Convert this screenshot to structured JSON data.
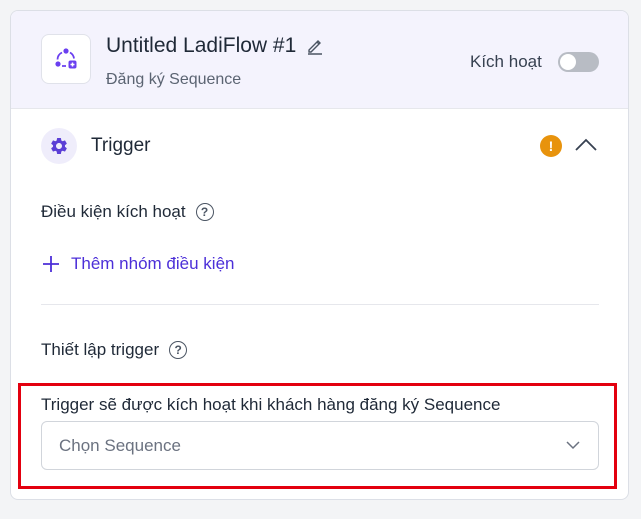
{
  "header": {
    "title": "Untitled LadiFlow #1",
    "subtitle": "Đăng ký Sequence",
    "activate_label": "Kích hoạt",
    "activate_enabled": false,
    "icons": {
      "flow": "flow-node-icon",
      "edit": "pencil-icon"
    }
  },
  "trigger_section": {
    "title": "Trigger",
    "warning_symbol": "!",
    "icons": {
      "section": "gear-icon",
      "warning": "warning-icon",
      "collapse": "chevron-up-icon"
    },
    "conditions_label": "Điều kiện kích hoạt",
    "add_group_label": "Thêm nhóm điều kiện",
    "setup_label": "Thiết lập trigger",
    "help_symbol": "?",
    "sequence_field_label": "Trigger sẽ được kích hoạt khi khách hàng đăng ký Sequence",
    "sequence_select_placeholder": "Chọn Sequence"
  },
  "colors": {
    "accent": "#4c2fd8",
    "header_bg": "#f4f3fd",
    "warning": "#e8930c",
    "highlight_border": "#e3000f"
  }
}
